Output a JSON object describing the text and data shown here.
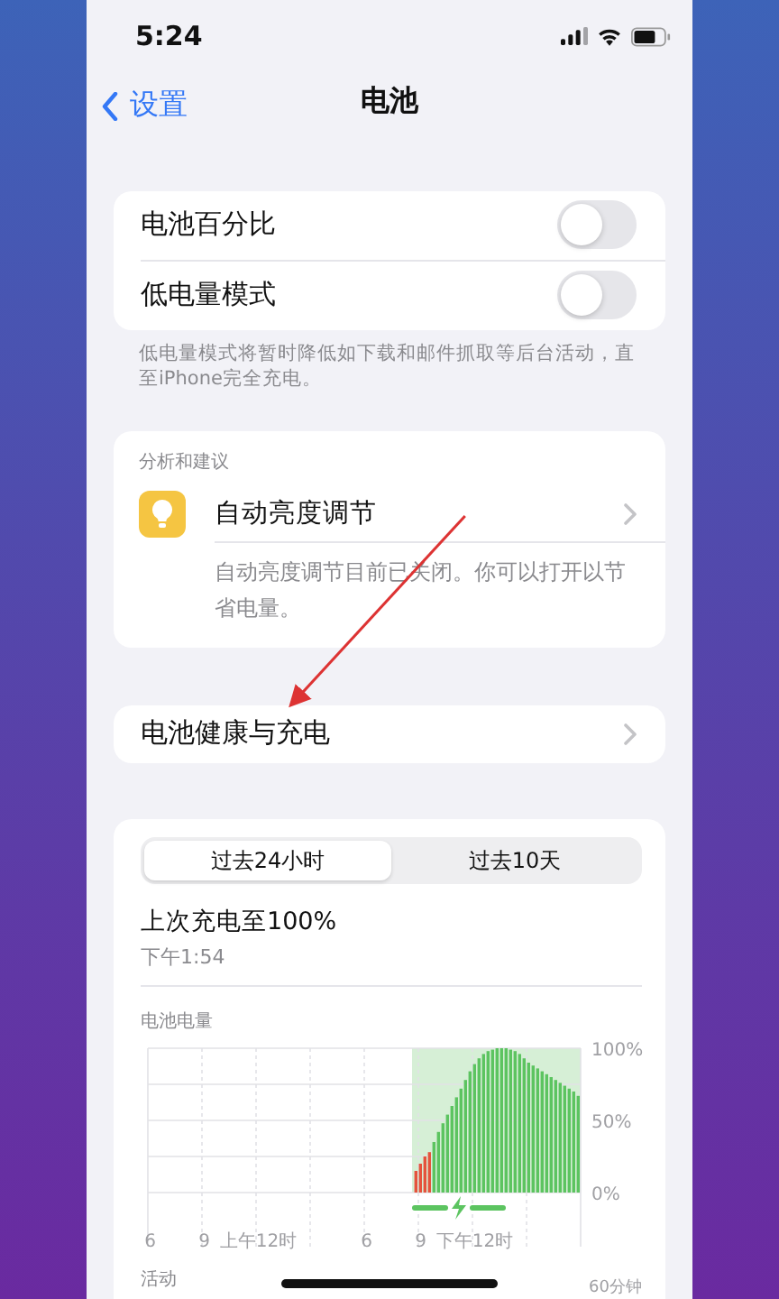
{
  "status_bar": {
    "time": "5:24"
  },
  "nav": {
    "back": "设置",
    "title": "电池"
  },
  "toggles": [
    {
      "label": "电池百分比",
      "on": false
    },
    {
      "label": "低电量模式",
      "on": false
    }
  ],
  "toggles_footnote": "低电量模式将暂时降低如下载和邮件抓取等后台活动，直至iPhone完全充电。",
  "insights": {
    "header": "分析和建议",
    "items": [
      {
        "title": "自动亮度调节",
        "description": "自动亮度调节目前已关闭。你可以打开以节省电量。"
      }
    ]
  },
  "health_link": "电池健康与充电",
  "usage": {
    "tabs": [
      {
        "label": "过去24小时",
        "selected": true
      },
      {
        "label": "过去10天",
        "selected": false
      }
    ],
    "last_charge": {
      "title": "上次充电至100%",
      "time": "下午1:54"
    },
    "chart_data": {
      "type": "bar",
      "title": "电池电量",
      "categories": [
        "6",
        null,
        null,
        null,
        null,
        null,
        null,
        null,
        null,
        null,
        null,
        null,
        "9",
        null,
        null,
        null,
        null,
        null,
        null,
        null,
        null,
        null,
        null,
        null,
        "上午12时",
        null,
        null,
        null,
        null,
        null,
        null,
        null,
        null,
        null,
        null,
        null,
        null,
        null,
        null,
        null,
        null,
        null,
        null,
        null,
        null,
        null,
        null,
        null,
        "6",
        null,
        null,
        null,
        null,
        null,
        null,
        null,
        null,
        null,
        null,
        null,
        "9",
        null,
        null,
        null,
        null,
        null,
        null,
        null,
        null,
        null,
        null,
        null,
        "下午12时",
        null,
        null,
        null,
        null,
        null,
        null,
        null,
        null,
        null,
        null,
        null,
        null,
        null,
        null,
        null,
        null,
        null,
        null,
        null,
        null,
        null,
        null,
        null
      ],
      "series": [
        {
          "color": "#e5533d",
          "values": [
            null,
            null,
            null,
            null,
            null,
            null,
            null,
            null,
            null,
            null,
            null,
            null,
            null,
            null,
            null,
            null,
            null,
            null,
            null,
            null,
            null,
            null,
            null,
            null,
            null,
            null,
            null,
            null,
            null,
            null,
            null,
            null,
            null,
            null,
            null,
            null,
            null,
            null,
            null,
            null,
            null,
            null,
            null,
            null,
            null,
            null,
            null,
            null,
            null,
            null,
            null,
            null,
            null,
            null,
            null,
            null,
            null,
            null,
            null,
            0.15,
            0.2,
            0.25,
            0.28,
            null,
            null,
            null,
            null,
            null,
            null,
            null,
            null,
            null,
            null,
            null,
            null,
            null,
            null,
            null,
            null,
            null,
            null,
            null,
            null,
            null,
            null,
            null,
            null,
            null,
            null,
            null,
            null,
            null,
            null,
            null,
            null,
            null
          ]
        },
        {
          "color": "#5cc460",
          "values": [
            null,
            null,
            null,
            null,
            null,
            null,
            null,
            null,
            null,
            null,
            null,
            null,
            null,
            null,
            null,
            null,
            null,
            null,
            null,
            null,
            null,
            null,
            null,
            null,
            null,
            null,
            null,
            null,
            null,
            null,
            null,
            null,
            null,
            null,
            null,
            null,
            null,
            null,
            null,
            null,
            null,
            null,
            null,
            null,
            null,
            null,
            null,
            null,
            null,
            null,
            null,
            null,
            null,
            null,
            null,
            null,
            null,
            null,
            null,
            null,
            null,
            null,
            null,
            0.35,
            0.42,
            0.48,
            0.54,
            0.6,
            0.66,
            0.72,
            0.78,
            0.84,
            0.89,
            0.93,
            0.96,
            0.98,
            0.99,
            1,
            1,
            1,
            0.99,
            0.98,
            0.96,
            0.93,
            0.9,
            0.88,
            0.86,
            0.84,
            0.82,
            0.8,
            0.78,
            0.76,
            0.74,
            0.72,
            0.7,
            0.67
          ]
        }
      ],
      "ylim": [
        0,
        1
      ],
      "yticks": [
        {
          "value": 0,
          "label": "0%"
        },
        {
          "value": 0.5,
          "label": "50%"
        },
        {
          "value": 1,
          "label": "100%"
        }
      ]
    },
    "activity": {
      "label": "活动",
      "axis_top": "60分钟"
    }
  }
}
